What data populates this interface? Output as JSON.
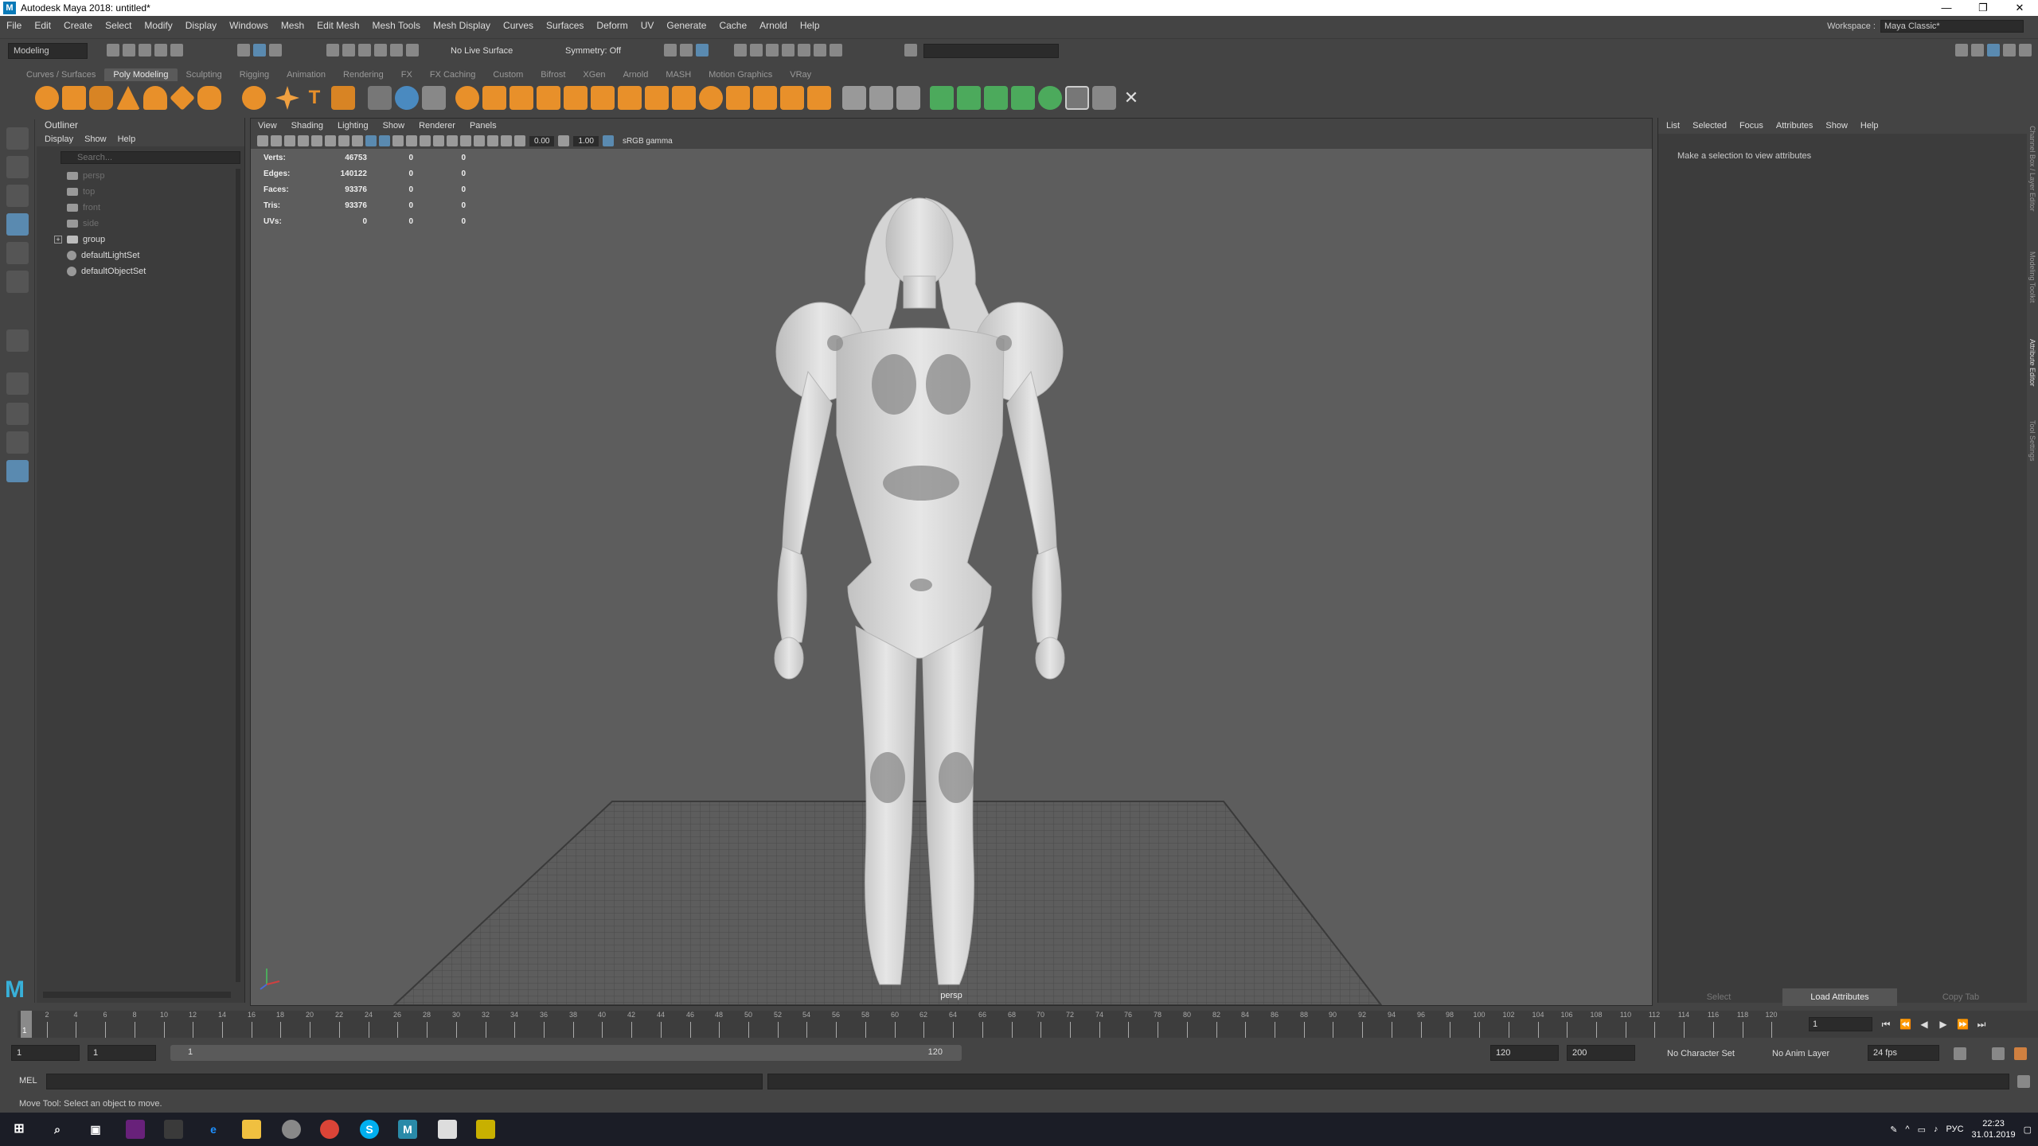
{
  "window": {
    "title": "Autodesk Maya 2018: untitled*",
    "minimize": "—",
    "maximize": "❐",
    "close": "✕"
  },
  "menu": [
    "File",
    "Edit",
    "Create",
    "Select",
    "Modify",
    "Display",
    "Windows",
    "Mesh",
    "Edit Mesh",
    "Mesh Tools",
    "Mesh Display",
    "Curves",
    "Surfaces",
    "Deform",
    "UV",
    "Generate",
    "Cache",
    "Arnold",
    "Help"
  ],
  "workspace": {
    "label": "Workspace :",
    "value": "Maya Classic*"
  },
  "statusline": {
    "mode": "Modeling",
    "live_surface": "No Live Surface",
    "symmetry": "Symmetry: Off"
  },
  "shelf_tabs": [
    "Curves / Surfaces",
    "Poly Modeling",
    "Sculpting",
    "Rigging",
    "Animation",
    "Rendering",
    "FX",
    "FX Caching",
    "Custom",
    "Bifrost",
    "XGen",
    "Arnold",
    "MASH",
    "Motion Graphics",
    "VRay"
  ],
  "shelf_active": "Poly Modeling",
  "outliner": {
    "title": "Outliner",
    "menu": [
      "Display",
      "Show",
      "Help"
    ],
    "search_placeholder": "Search...",
    "items": [
      {
        "label": "persp",
        "dim": true
      },
      {
        "label": "top",
        "dim": true
      },
      {
        "label": "front",
        "dim": true
      },
      {
        "label": "side",
        "dim": true
      },
      {
        "label": "group",
        "dim": false
      },
      {
        "label": "defaultLightSet",
        "dim": false
      },
      {
        "label": "defaultObjectSet",
        "dim": false
      }
    ]
  },
  "viewport": {
    "menu": [
      "View",
      "Shading",
      "Lighting",
      "Show",
      "Renderer",
      "Panels"
    ],
    "exposure": "0.00",
    "gamma": "1.00",
    "color_space": "sRGB gamma",
    "camera": "persp",
    "hud": [
      {
        "label": "Verts:",
        "v1": "46753",
        "v2": "0",
        "v3": "0"
      },
      {
        "label": "Edges:",
        "v1": "140122",
        "v2": "0",
        "v3": "0"
      },
      {
        "label": "Faces:",
        "v1": "93376",
        "v2": "0",
        "v3": "0"
      },
      {
        "label": "Tris:",
        "v1": "93376",
        "v2": "0",
        "v3": "0"
      },
      {
        "label": "UVs:",
        "v1": "0",
        "v2": "0",
        "v3": "0"
      }
    ]
  },
  "attribute_editor": {
    "menu": [
      "List",
      "Selected",
      "Focus",
      "Attributes",
      "Show",
      "Help"
    ],
    "message": "Make a selection to view attributes",
    "buttons": {
      "select": "Select",
      "load": "Load Attributes",
      "copy": "Copy Tab"
    },
    "side_tabs": [
      "Channel Box / Layer Editor",
      "Modeling Toolkit",
      "Attribute Editor",
      "Tool Settings"
    ]
  },
  "timeline": {
    "ticks": [
      "2",
      "4",
      "6",
      "8",
      "10",
      "12",
      "14",
      "16",
      "18",
      "20",
      "22",
      "24",
      "26",
      "28",
      "30",
      "32",
      "34",
      "36",
      "38",
      "40",
      "42",
      "44",
      "46",
      "48",
      "50",
      "52",
      "54",
      "56",
      "58",
      "60",
      "62",
      "64",
      "66",
      "68",
      "70",
      "72",
      "74",
      "76",
      "78",
      "80",
      "82",
      "84",
      "86",
      "88",
      "90",
      "92",
      "94",
      "96",
      "98",
      "100",
      "102",
      "104",
      "106",
      "108",
      "110",
      "112",
      "114",
      "116",
      "118",
      "120"
    ],
    "current_frame": "1",
    "playback_frame": "1"
  },
  "range": {
    "start": "1",
    "anim_start": "1",
    "range_left": "1",
    "range_right": "120",
    "end": "120",
    "anim_end": "200",
    "character_set": "No Character Set",
    "anim_layer": "No Anim Layer",
    "fps": "24 fps"
  },
  "command": {
    "label": "MEL"
  },
  "help_line": "Move Tool: Select an object to move.",
  "taskbar": {
    "lang": "РУС",
    "time": "22:23",
    "date": "31.01.2019"
  },
  "colors": {
    "maya_blue": "#5a8ab0",
    "shelf_orange": "#e8902a",
    "shelf_green": "#4caa5c",
    "viewport_bg": "#5d5d5d"
  }
}
